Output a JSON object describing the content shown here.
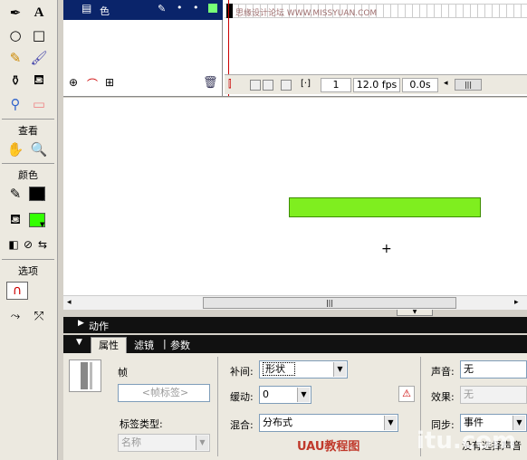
{
  "timeline": {
    "layer_name": "色",
    "watermark_text": "思缘设计论坛 WWW.MISSYUAN.COM",
    "frame_number": "1",
    "fps": "12.0 fps",
    "time": "0.0s"
  },
  "toolbar": {
    "view_label": "查看",
    "colors_label": "颜色",
    "options_label": "选项",
    "stroke_color": "#000000",
    "fill_color": "#33ff00"
  },
  "stage": {
    "rect_color": "#7fee1f",
    "rect_border": "#3d8d00",
    "crosshair": "+"
  },
  "panels": {
    "actions_label": "动作",
    "tabs": [
      "属性",
      "滤镜",
      "参数"
    ]
  },
  "properties": {
    "frame_label": "帧",
    "frame_label_placeholder": "<帧标签>",
    "label_type_label": "标签类型:",
    "label_type_value": "名称",
    "tween_label": "补间:",
    "tween_value": "形状",
    "ease_label": "缓动:",
    "ease_value": "0",
    "blend_label": "混合:",
    "blend_value": "分布式",
    "sound_label": "声音:",
    "sound_value": "无",
    "effect_label": "效果:",
    "effect_value": "无",
    "sync_label": "同步:",
    "sync_value": "事件",
    "no_sound_text": "没有选择声音"
  },
  "watermark": {
    "uau_text": "UAU教程图",
    "corner_text": "itu.com"
  }
}
